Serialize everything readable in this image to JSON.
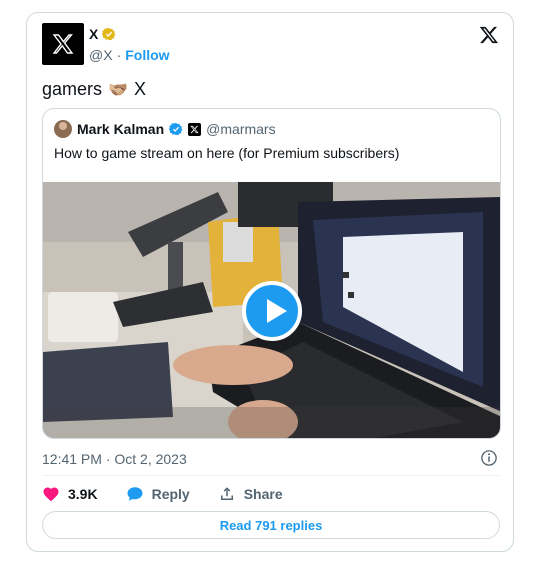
{
  "author": {
    "name": "X",
    "handle": "@X",
    "separator": "·",
    "follow_label": "Follow",
    "avatar_icon": "x-logo-icon",
    "badge": "gold-verified-icon",
    "badge_color": "#e2b719"
  },
  "tweet": {
    "text_before": "gamers",
    "emoji": "🫱🏼‍🫲🏽",
    "text_after": "X"
  },
  "quoted": {
    "name": "Mark Kalman",
    "handle": "@marmars",
    "text": "How to game stream on here (for Premium subscribers)",
    "badge": "blue-verified-icon",
    "affiliate_badge": "x-affiliate-badge"
  },
  "meta": {
    "timestamp": "12:41 PM · Oct 2, 2023"
  },
  "actions": {
    "likes": "3.9K",
    "reply_label": "Reply",
    "share_label": "Share"
  },
  "replies_button": "Read 791 replies",
  "colors": {
    "accent": "#1d9bf0",
    "like": "#f91880",
    "muted": "#536471",
    "border": "#cfd9de"
  }
}
